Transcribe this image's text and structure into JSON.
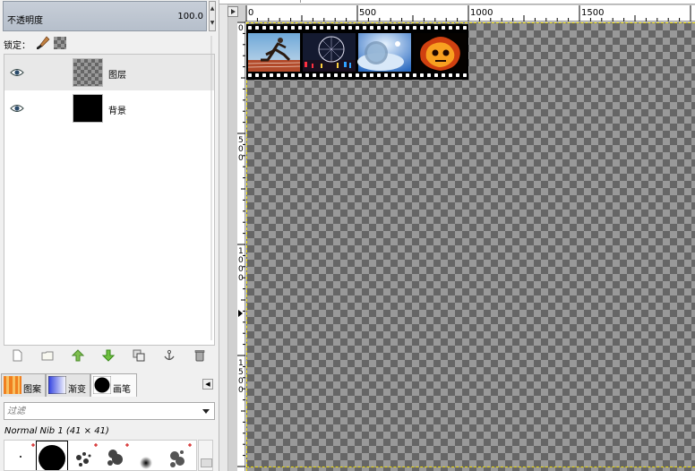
{
  "layers_panel": {
    "opacity_label": "不透明度",
    "opacity_value": "100.0",
    "lock_label": "锁定：",
    "layers": [
      {
        "name": "图层",
        "visible": true,
        "thumbnail": "transparent-checker",
        "selected": true
      },
      {
        "name": "背景",
        "visible": true,
        "thumbnail": "black",
        "selected": false
      }
    ],
    "buttons": [
      "new-layer-icon",
      "new-group-icon",
      "raise-layer-icon",
      "lower-layer-icon",
      "duplicate-layer-icon",
      "anchor-layer-icon",
      "delete-layer-icon"
    ]
  },
  "brush_panel": {
    "tabs": [
      {
        "label": "图案",
        "icon": "pattern-icon"
      },
      {
        "label": "渐变",
        "icon": "gradient-icon"
      },
      {
        "label": "画笔",
        "icon": "brush-icon",
        "active": true
      }
    ],
    "filter_placeholder": "过滤",
    "selected_brush": "Normal Nib 1 (41 × 41)"
  },
  "rulers": {
    "horizontal": [
      "0",
      "500",
      "1000",
      "1500"
    ],
    "vertical": [
      "0",
      "500",
      "1000",
      "1500"
    ]
  },
  "colors": {
    "selection": "#e6d500",
    "checker_dark": "#666666",
    "checker_light": "#999999"
  }
}
